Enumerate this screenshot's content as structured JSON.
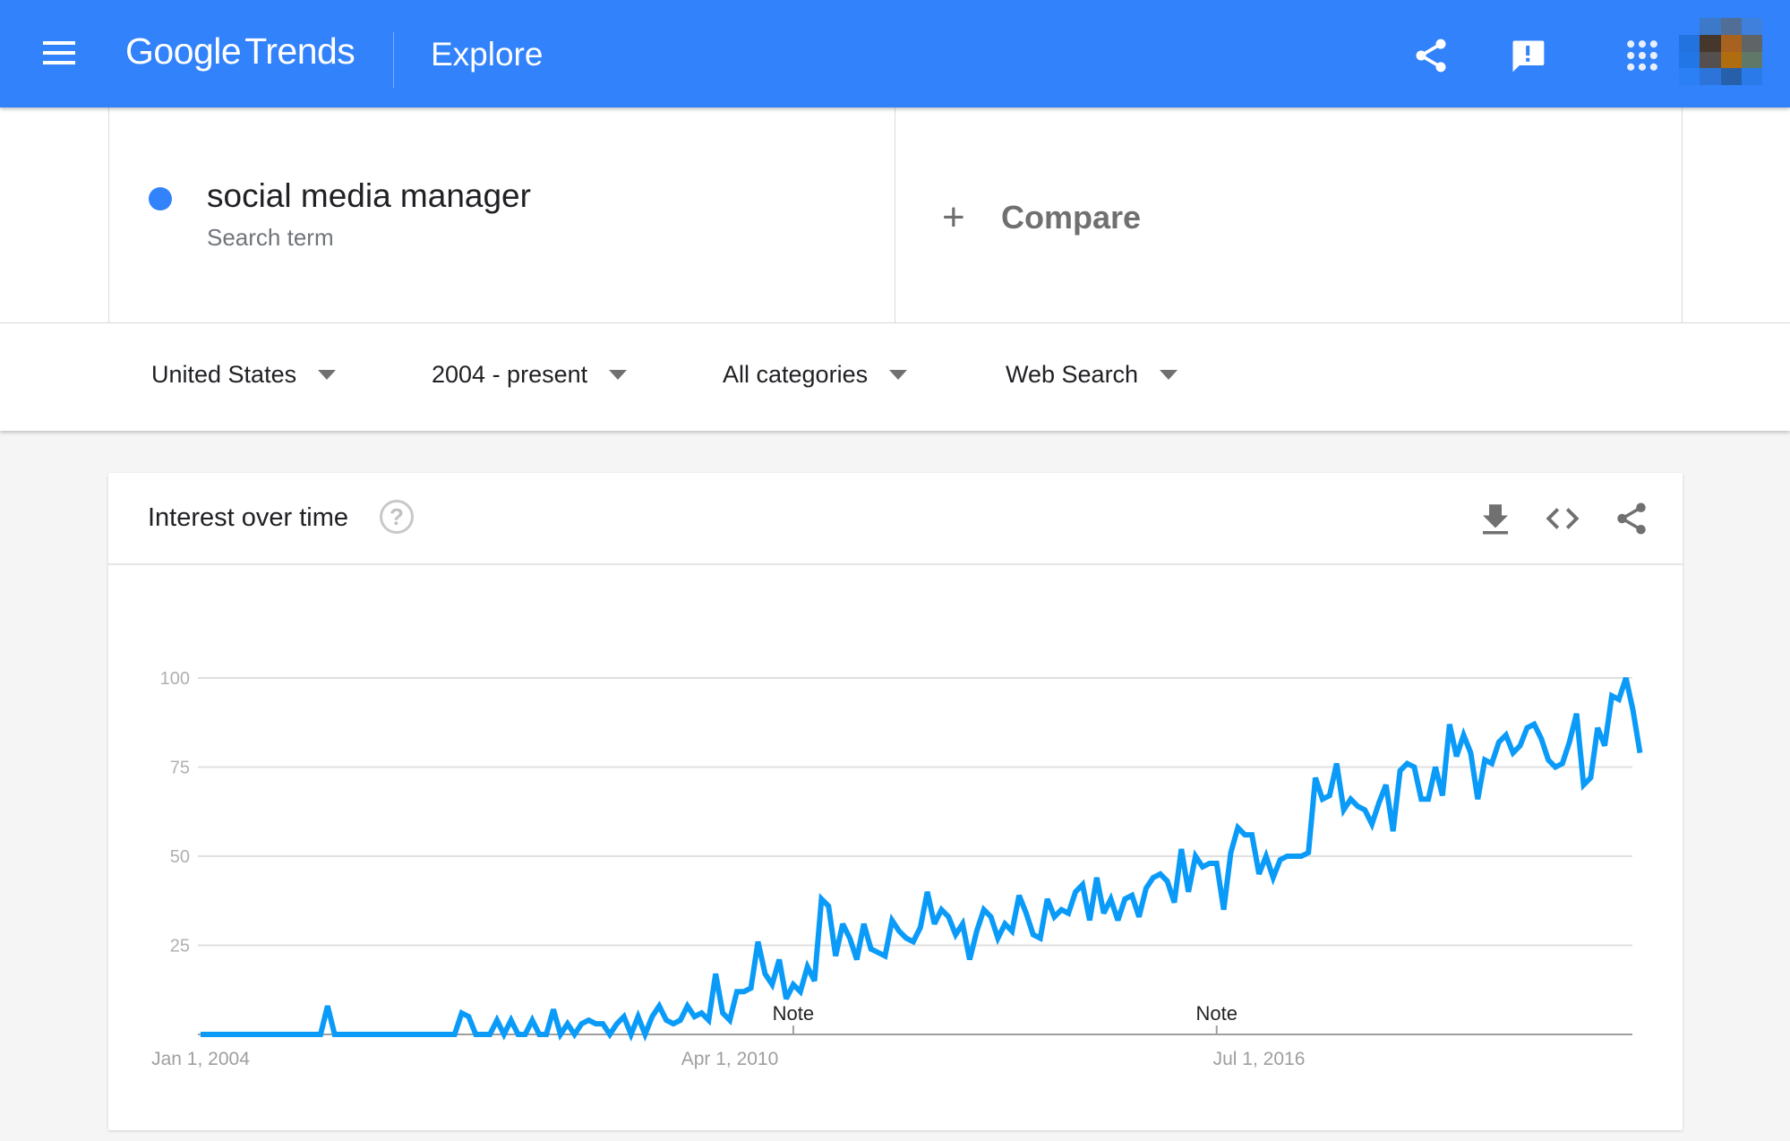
{
  "header": {
    "logo_google": "Google",
    "logo_trends": "Trends",
    "page_title": "Explore",
    "icons": [
      "menu-icon",
      "share-icon",
      "feedback-icon",
      "apps-icon",
      "avatar"
    ],
    "brand_color": "#3182fb"
  },
  "search": {
    "term": "social media manager",
    "term_type": "Search term",
    "term_color": "#3182fb",
    "compare_label": "Compare"
  },
  "filters": [
    {
      "label": "United States"
    },
    {
      "label": "2004 - present"
    },
    {
      "label": "All categories"
    },
    {
      "label": "Web Search"
    }
  ],
  "card": {
    "title": "Interest over time",
    "help": "?",
    "actions": [
      "download-icon",
      "embed-icon",
      "share-icon"
    ]
  },
  "chart_data": {
    "type": "line",
    "title": "Interest over time",
    "xlabel": "",
    "ylabel": "",
    "ylim": [
      0,
      100
    ],
    "yticks": [
      25,
      50,
      75,
      100
    ],
    "xticks": [
      {
        "label": "Jan 1, 2004",
        "index": 0
      },
      {
        "label": "Apr 1, 2010",
        "index": 75
      },
      {
        "label": "Jul 1, 2016",
        "index": 150
      }
    ],
    "annotations": [
      {
        "label": "Note",
        "index": 84
      },
      {
        "label": "Note",
        "index": 144
      }
    ],
    "grid": true,
    "legend": "none",
    "x_start": "Jan 2004",
    "x_step": "month",
    "series": [
      {
        "name": "social media manager",
        "color": "#0a9bf8",
        "values": [
          0,
          0,
          0,
          0,
          0,
          0,
          0,
          0,
          0,
          0,
          0,
          0,
          0,
          0,
          0,
          0,
          0,
          0,
          8,
          0,
          0,
          0,
          0,
          0,
          0,
          0,
          0,
          0,
          0,
          0,
          0,
          0,
          0,
          0,
          0,
          0,
          0,
          6,
          5,
          0,
          0,
          0,
          4,
          0,
          4,
          0,
          0,
          4,
          0,
          0,
          7,
          0,
          3,
          0,
          3,
          4,
          3,
          3,
          0,
          3,
          5,
          0,
          5,
          0,
          5,
          8,
          4,
          3,
          4,
          8,
          5,
          6,
          4,
          17,
          6,
          4,
          12,
          12,
          13,
          26,
          17,
          14,
          21,
          10,
          14,
          12,
          19,
          15,
          38,
          36,
          22,
          31,
          27,
          21,
          31,
          24,
          23,
          22,
          32,
          29,
          27,
          26,
          30,
          40,
          31,
          35,
          33,
          28,
          31,
          21,
          29,
          35,
          33,
          27,
          31,
          29,
          39,
          34,
          28,
          27,
          38,
          33,
          35,
          34,
          40,
          42,
          32,
          44,
          34,
          38,
          32,
          38,
          39,
          33,
          41,
          44,
          45,
          43,
          37,
          52,
          40,
          50,
          47,
          48,
          48,
          35,
          51,
          58,
          56,
          56,
          45,
          50,
          44,
          49,
          50,
          50,
          50,
          51,
          72,
          66,
          67,
          76,
          63,
          66,
          64,
          63,
          59,
          65,
          70,
          57,
          74,
          76,
          75,
          66,
          66,
          75,
          67,
          87,
          78,
          84,
          79,
          66,
          77,
          76,
          82,
          84,
          79,
          81,
          86,
          87,
          83,
          77,
          75,
          76,
          82,
          90,
          70,
          72,
          86,
          81,
          95,
          94,
          100,
          91,
          79
        ]
      }
    ]
  }
}
